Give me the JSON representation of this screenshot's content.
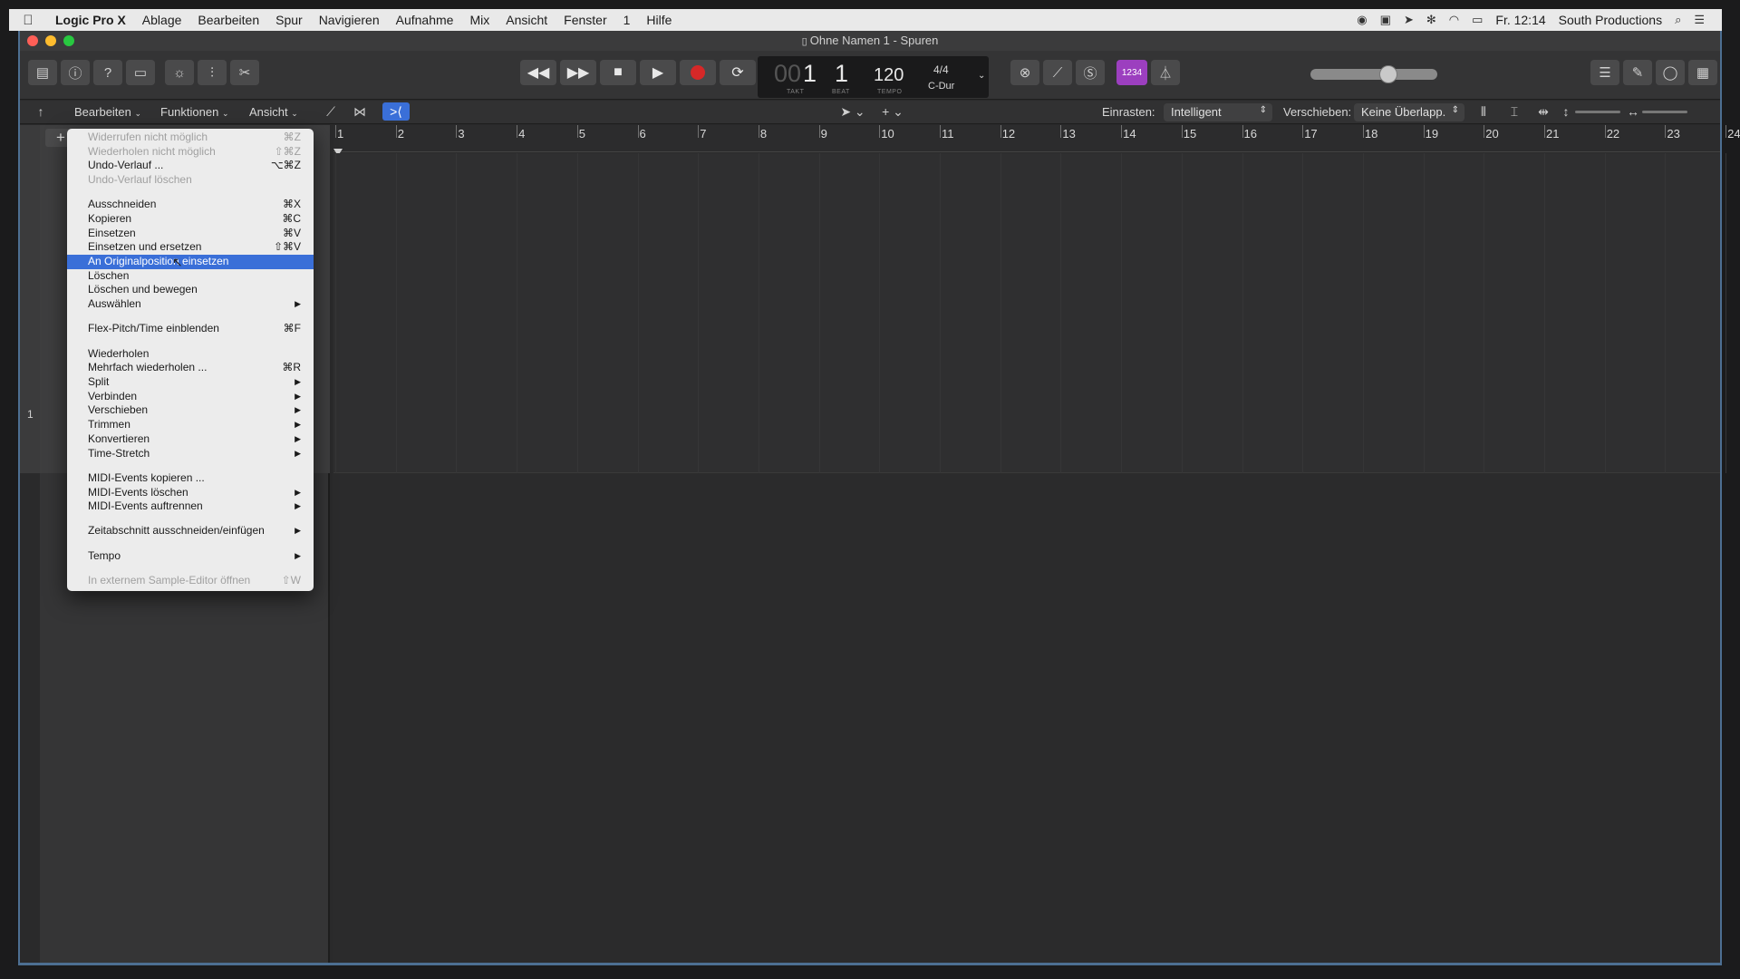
{
  "menubar": {
    "app": "Logic Pro X",
    "items": [
      "Ablage",
      "Bearbeiten",
      "Spur",
      "Navigieren",
      "Aufnahme",
      "Mix",
      "Ansicht",
      "Fenster",
      "1",
      "Hilfe"
    ],
    "clock": "Fr. 12:14",
    "user": "South Productions"
  },
  "window": {
    "title": "Ohne Namen 1 - Spuren"
  },
  "lcd": {
    "takt_value": "1",
    "takt_prefix": "00",
    "beat_value": "1",
    "tempo_value": "120",
    "takt_label": "TAKT",
    "beat_label": "BEAT",
    "tempo_label": "TEMPO",
    "signature": "4/4",
    "key": "C-Dur"
  },
  "countin": "1234",
  "trackbar": {
    "bearbeiten": "Bearbeiten",
    "funktionen": "Funktionen",
    "ansicht": "Ansicht",
    "einrasten_label": "Einrasten:",
    "einrasten_value": "Intelligent",
    "verschieben_label": "Verschieben:",
    "verschieben_value": "Keine Überlapp."
  },
  "track_number": "1",
  "ruler": [
    "1",
    "2",
    "3",
    "4",
    "5",
    "6",
    "7",
    "8",
    "9",
    "10",
    "11",
    "12",
    "13",
    "14",
    "15",
    "16",
    "17",
    "18",
    "19",
    "20",
    "21",
    "22",
    "23",
    "24"
  ],
  "menu": [
    {
      "label": "Widerrufen nicht möglich",
      "shortcut": "⌘Z",
      "disabled": true
    },
    {
      "label": "Wiederholen nicht möglich",
      "shortcut": "⇧⌘Z",
      "disabled": true
    },
    {
      "label": "Undo-Verlauf ...",
      "shortcut": "⌥⌘Z"
    },
    {
      "label": "Undo-Verlauf löschen",
      "shortcut": "",
      "disabled": true
    },
    {
      "sep": true
    },
    {
      "label": "Ausschneiden",
      "shortcut": "⌘X"
    },
    {
      "label": "Kopieren",
      "shortcut": "⌘C"
    },
    {
      "label": "Einsetzen",
      "shortcut": "⌘V"
    },
    {
      "label": "Einsetzen und ersetzen",
      "shortcut": "⇧⌘V"
    },
    {
      "label": "An Originalposition einsetzen",
      "shortcut": "",
      "selected": true
    },
    {
      "label": "Löschen",
      "shortcut": ""
    },
    {
      "label": "Löschen und bewegen",
      "shortcut": ""
    },
    {
      "label": "Auswählen",
      "submenu": true
    },
    {
      "sep": true
    },
    {
      "label": "Flex-Pitch/Time einblenden",
      "shortcut": "⌘F"
    },
    {
      "sep": true
    },
    {
      "label": "Wiederholen",
      "shortcut": ""
    },
    {
      "label": "Mehrfach wiederholen ...",
      "shortcut": "⌘R"
    },
    {
      "label": "Split",
      "submenu": true
    },
    {
      "label": "Verbinden",
      "submenu": true
    },
    {
      "label": "Verschieben",
      "submenu": true
    },
    {
      "label": "Trimmen",
      "submenu": true
    },
    {
      "label": "Konvertieren",
      "submenu": true
    },
    {
      "label": "Time-Stretch",
      "submenu": true
    },
    {
      "sep": true
    },
    {
      "label": "MIDI-Events kopieren ...",
      "shortcut": ""
    },
    {
      "label": "MIDI-Events löschen",
      "submenu": true
    },
    {
      "label": "MIDI-Events auftrennen",
      "submenu": true
    },
    {
      "sep": true
    },
    {
      "label": "Zeitabschnitt ausschneiden/einfügen",
      "submenu": true
    },
    {
      "sep": true
    },
    {
      "label": "Tempo",
      "submenu": true
    },
    {
      "sep": true
    },
    {
      "label": "In externem Sample-Editor öffnen",
      "shortcut": "⇧W",
      "disabled": true
    }
  ],
  "colors": {
    "record": "#d62828",
    "countin_bg": "#9c3fbf",
    "menu_highlight": "#3a6fd8",
    "window_border": "#4d6f92"
  }
}
